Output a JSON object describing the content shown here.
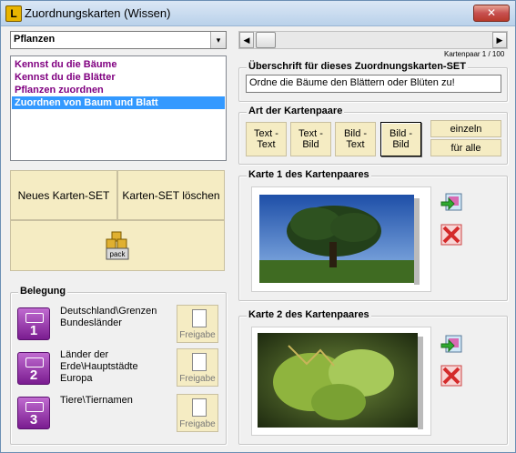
{
  "window": {
    "title": "Zuordnungskarten (Wissen)",
    "close_glyph": "✕"
  },
  "category_select": {
    "value": "Pflanzen",
    "arrow": "▾"
  },
  "set_list": [
    {
      "label": "Kennst du die Bäume",
      "selected": false
    },
    {
      "label": "Kennst du die Blätter",
      "selected": false
    },
    {
      "label": "Pflanzen zuordnen",
      "selected": false
    },
    {
      "label": "Zuordnen von Baum und Blatt",
      "selected": true
    }
  ],
  "pager": {
    "label": "Kartenpaar 1 / 100",
    "left_arrow": "◀",
    "right_arrow": "▶"
  },
  "heading_group": {
    "label": "Überschrift für dieses Zuordnungskarten-SET",
    "value": "Ordne die Bäume den Blättern oder Blüten zu!"
  },
  "pair_type_group": {
    "label": "Art der Kartenpaare",
    "buttons": [
      {
        "line1": "Text -",
        "line2": "Text"
      },
      {
        "line1": "Text -",
        "line2": "Bild"
      },
      {
        "line1": "Bild -",
        "line2": "Text"
      },
      {
        "line1": "Bild -",
        "line2": "Bild"
      }
    ],
    "single_label": "einzeln",
    "all_label": "für alle"
  },
  "card1": {
    "label": "Karte 1 des Kartenpaares"
  },
  "card2": {
    "label": "Karte 2 des Kartenpaares"
  },
  "actions": {
    "new_set": "Neues Karten-SET",
    "delete_set": "Karten-SET löschen",
    "pack": "pack"
  },
  "belegung": {
    "label": "Belegung",
    "items": [
      {
        "number": "1",
        "line1": "Deutschland\\Grenzen",
        "line2": "Bundesländer",
        "line3": "",
        "freigabe": "Freigabe"
      },
      {
        "number": "2",
        "line1": "Länder der",
        "line2": "Erde\\Hauptstädte",
        "line3": "Europa",
        "freigabe": "Freigabe"
      },
      {
        "number": "3",
        "line1": "Tiere\\Tiernamen",
        "line2": "",
        "line3": "",
        "freigabe": "Freigabe"
      }
    ]
  },
  "colors": {
    "accent": "#3399ff",
    "list_text": "#800080",
    "button_bg": "#f5ecc3",
    "slot_purple": "#7a1c90"
  }
}
